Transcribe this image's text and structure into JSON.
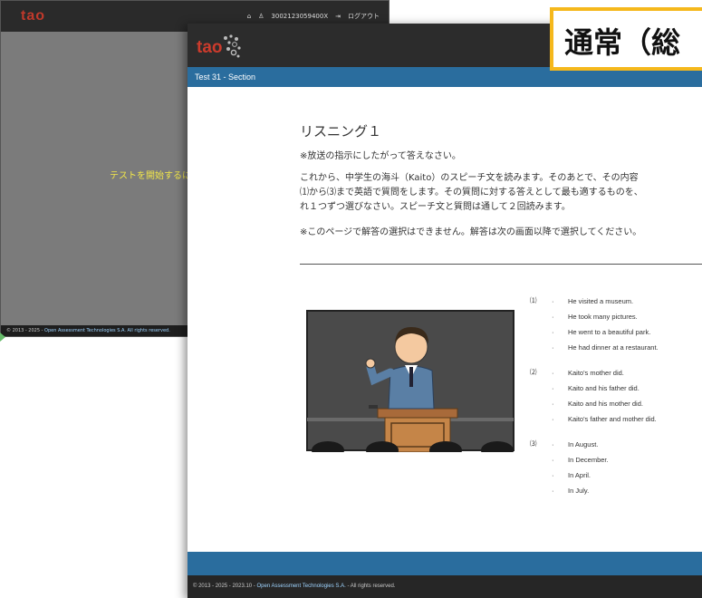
{
  "background_window": {
    "logo": "tao",
    "nav_user": "3002123059400X",
    "nav_logout": "ログアウト",
    "message": "テストを開始するに",
    "footer_prefix": "© 2013 - 2025 -",
    "footer_org": "Open Assessment Technologies S.A. All rights reserved."
  },
  "front_window": {
    "logo": "tao",
    "section_title": "Test 31 - Section",
    "content": {
      "title": "リスニング１",
      "instruction": "※放送の指示にしたがって答えなさい。",
      "paragraph_lines": [
        "これから、中学生の海斗（Kaito）のスピーチ文を読みます。そのあとで、その内容",
        "⑴から⑶まで英語で質問をします。その質問に対する答えとして最も適するものを、",
        "れ１つずつ選びなさい。スピーチ文と質問は通して２回読みます。"
      ],
      "note": "※このページで解答の選択はできません。解答は次の画面以降で選択してください。"
    },
    "questions": [
      {
        "number": "⑴",
        "options": [
          "He visited a museum.",
          "He took many pictures.",
          "He went to a beautiful park.",
          "He had dinner at a restaurant."
        ]
      },
      {
        "number": "⑵",
        "options": [
          "Kaito's mother did.",
          "Kaito and his father did.",
          "Kaito and his mother did.",
          "Kaito's father and mother did."
        ]
      },
      {
        "number": "⑶",
        "options": [
          "In August.",
          "In December.",
          "In April.",
          "In July."
        ]
      }
    ],
    "footer_prefix": "© 2013 - 2025 - 2023.10 -",
    "footer_org": "Open Assessment Technologies S.A.",
    "footer_suffix": "- All rights reserved."
  },
  "banner": {
    "text": "通常（総"
  },
  "colors": {
    "header_dark": "#2c2c2c",
    "section_blue": "#2a6d9e",
    "banner_border": "#f5b81c",
    "logo_red": "#cc3b2c",
    "bg_window_gray": "#7b7b7b",
    "bg_message_yellow": "#f1e64a"
  }
}
